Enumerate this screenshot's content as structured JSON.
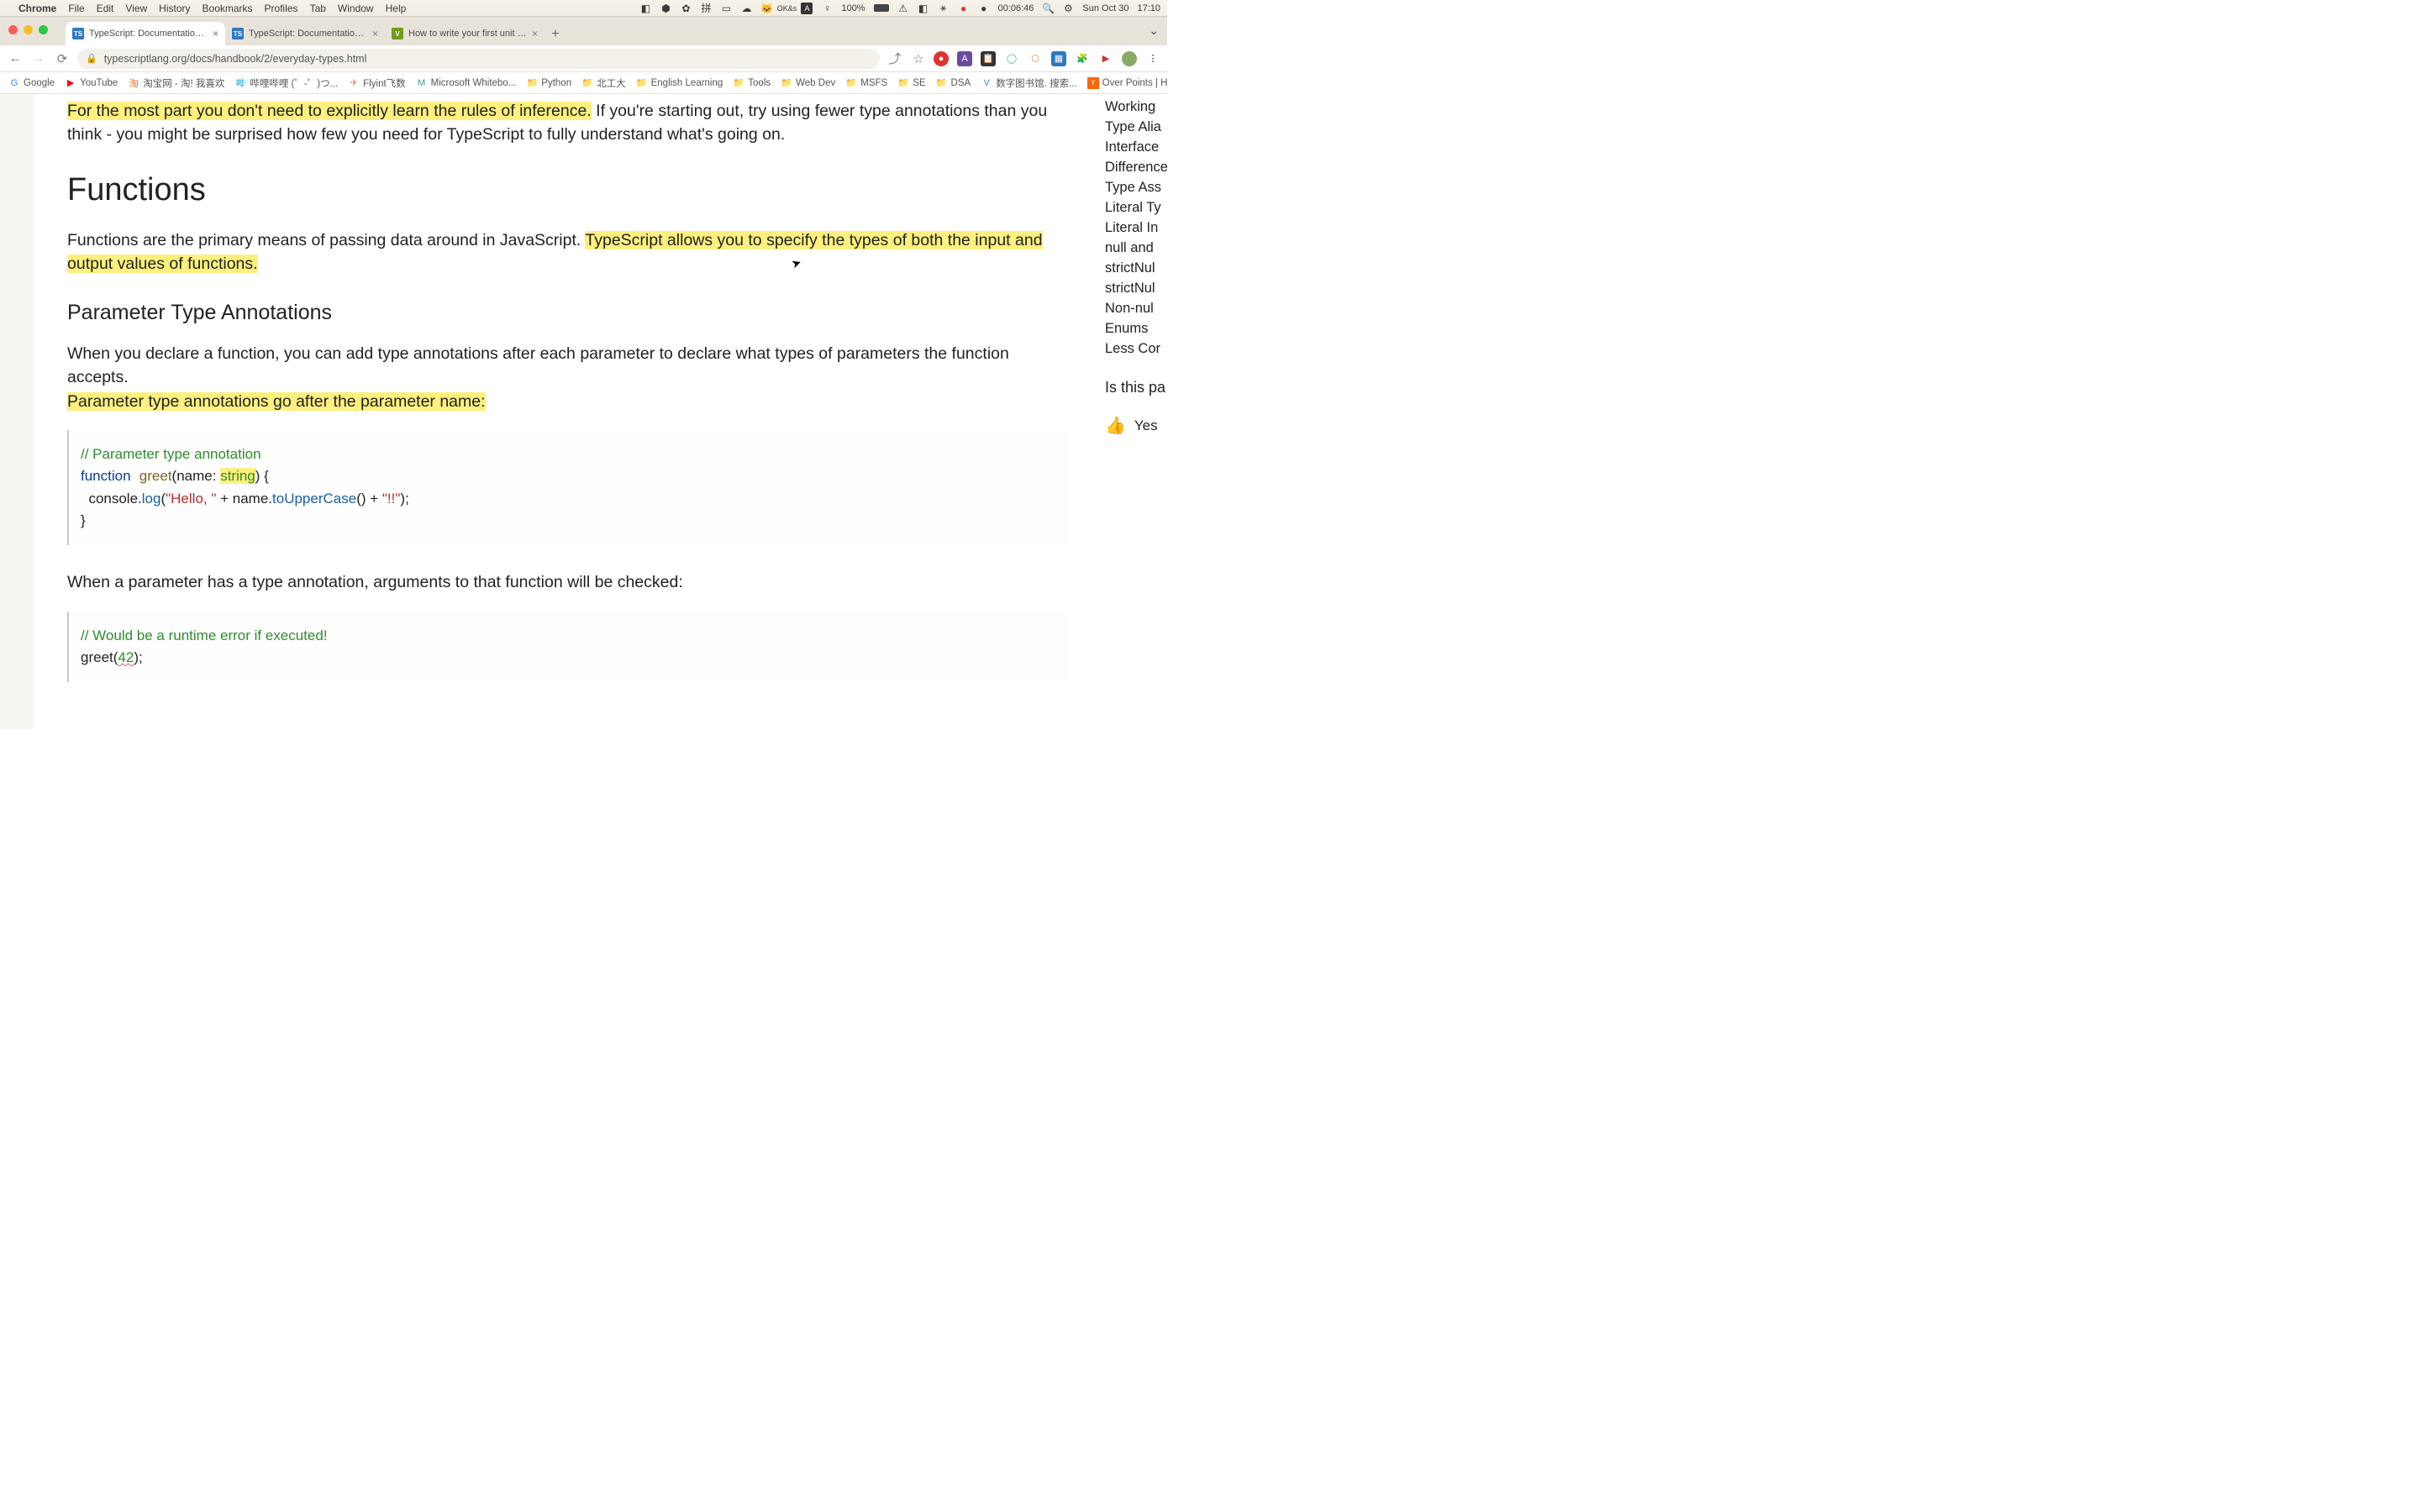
{
  "menubar": {
    "app": "Chrome",
    "items": [
      "File",
      "Edit",
      "View",
      "History",
      "Bookmarks",
      "Profiles",
      "Tab",
      "Window",
      "Help"
    ],
    "right": {
      "battery": "100%",
      "time_elapsed": "00:06:46",
      "date": "Sun Oct 30",
      "time": "17:10"
    }
  },
  "tabs": [
    {
      "title": "TypeScript: Documentation - E",
      "favicon": "TS",
      "active": true
    },
    {
      "title": "TypeScript: Documentation - N",
      "favicon": "TS",
      "active": false
    },
    {
      "title": "How to write your first unit tes",
      "favicon": "V",
      "active": false
    }
  ],
  "addressbar": {
    "url": "typescriptlang.org/docs/handbook/2/everyday-types.html"
  },
  "bookmarks": [
    {
      "icon": "G",
      "label": "Google"
    },
    {
      "icon": "▶",
      "label": "YouTube"
    },
    {
      "icon": "淘",
      "label": "淘宝网 - 淘! 我喜欢"
    },
    {
      "icon": "哔",
      "label": "哔哩哔哩 (゜-゜)つ..."
    },
    {
      "icon": "✈",
      "label": "Flyint飞数"
    },
    {
      "icon": "M",
      "label": "Microsoft Whitebo..."
    },
    {
      "icon": "📁",
      "label": "Python"
    },
    {
      "icon": "📁",
      "label": "北工大"
    },
    {
      "icon": "📁",
      "label": "English Learning"
    },
    {
      "icon": "📁",
      "label": "Tools"
    },
    {
      "icon": "📁",
      "label": "Web Dev"
    },
    {
      "icon": "📁",
      "label": "MSFS"
    },
    {
      "icon": "📁",
      "label": "SE"
    },
    {
      "icon": "📁",
      "label": "DSA"
    },
    {
      "icon": "V",
      "label": "数字图书馆. 搜索..."
    },
    {
      "icon": "🟧",
      "label": "Over Points | Hack..."
    }
  ],
  "content": {
    "p1_hl": "For the most part you don't need to explicitly learn the rules of inference.",
    "p1_rest": " If you're starting out, try using fewer type annotations than you think - you might be surprised how few you need for TypeScript to fully understand what's going on.",
    "h1": "Functions",
    "p2_pre": "Functions are the primary means of passing data around in JavaScript. ",
    "p2_hl": "TypeScript allows you to specify the types of both the input and output values of functions.",
    "h2": "Parameter Type Annotations",
    "p3_pre": "When you declare a function, you can add type annotations after each parameter to declare what types of parameters the function accepts.",
    "p3_hl": "Parameter type annotations go after the parameter name:",
    "code1": {
      "comment": "// Parameter type annotation",
      "kw_function": "function",
      "fn_name": "greet",
      "param_open": "(name: ",
      "type": "string",
      "param_close": ") {",
      "line3_pre": "  console.",
      "log": "log",
      "line3_mid": "(",
      "str1": "\"Hello, \"",
      "line3_plus": " + name.",
      "method": "toUpperCase",
      "line3_end": "() + ",
      "str2": "\"!!\"",
      "line3_close": ");",
      "close": "}"
    },
    "p4": "When a parameter has a type annotation, arguments to that function will be checked:",
    "code2": {
      "comment": "// Would be a runtime error if executed!",
      "call_pre": "greet(",
      "num": "42",
      "call_post": ");"
    }
  },
  "sidebar": {
    "items": [
      "Working",
      "Type Alia",
      "Interface",
      "Difference",
      "Type Ass",
      "Literal Ty",
      "Literal In",
      "null and",
      "strictNul",
      "strictNul",
      "Non-nul",
      "Enums",
      "Less Cor"
    ],
    "question": "Is this pa",
    "yes": "Yes"
  }
}
